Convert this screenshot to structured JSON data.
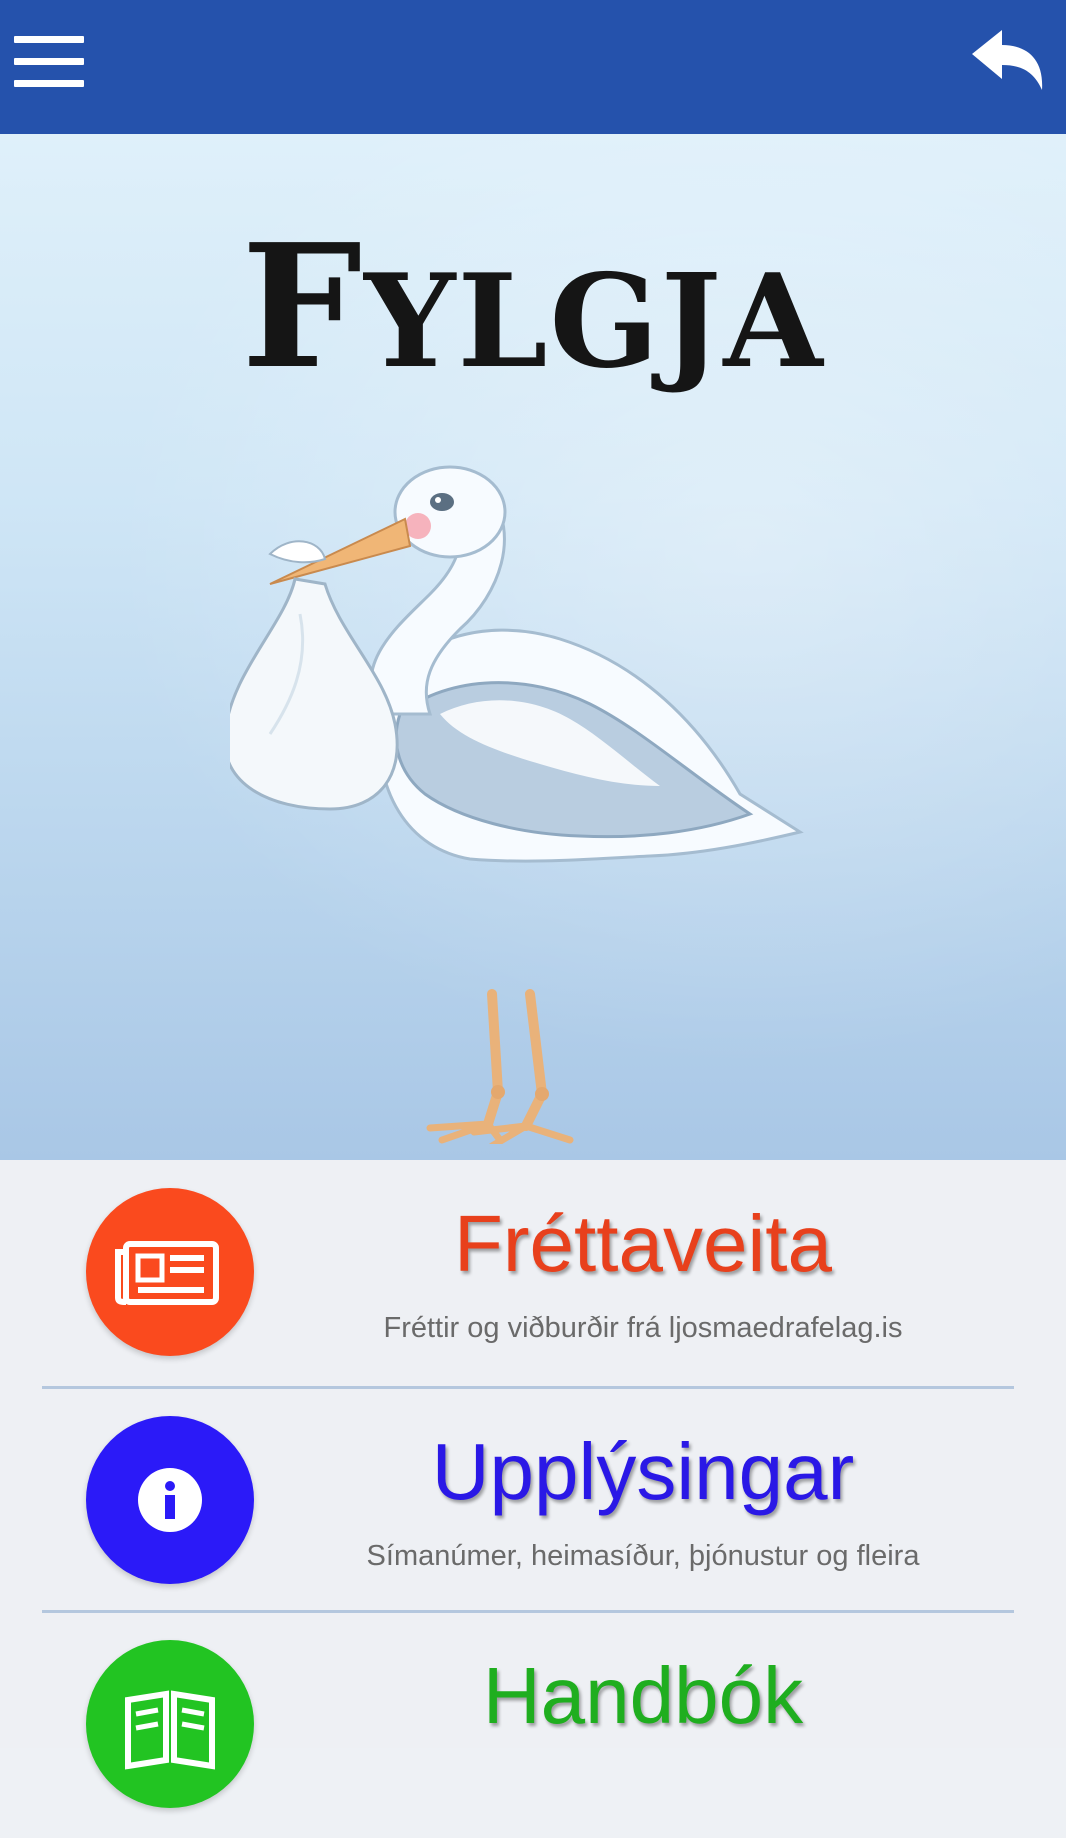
{
  "header": {
    "menu_icon": "hamburger-menu-icon",
    "back_icon": "reply-back-arrow-icon",
    "background_color": "#2552ac"
  },
  "hero": {
    "title_first": "F",
    "title_rest": "YLGJA",
    "image": "stork-carrying-baby-bundle"
  },
  "menu": {
    "items": [
      {
        "title": "Fréttaveita",
        "subtitle": "Fréttir og viðburðir frá ljosmaedrafelag.is",
        "icon": "newspaper-icon",
        "color": "#fa4a1e",
        "title_color": "#e8401c"
      },
      {
        "title": "Upplýsingar",
        "subtitle": "Símanúmer, heimasíður, þjónustur og fleira",
        "icon": "info-icon",
        "color": "#2b1af8",
        "title_color": "#2a18e6"
      },
      {
        "title": "Handbók",
        "subtitle": "",
        "icon": "open-book-icon",
        "color": "#22c422",
        "title_color": "#1fae1f"
      }
    ]
  }
}
